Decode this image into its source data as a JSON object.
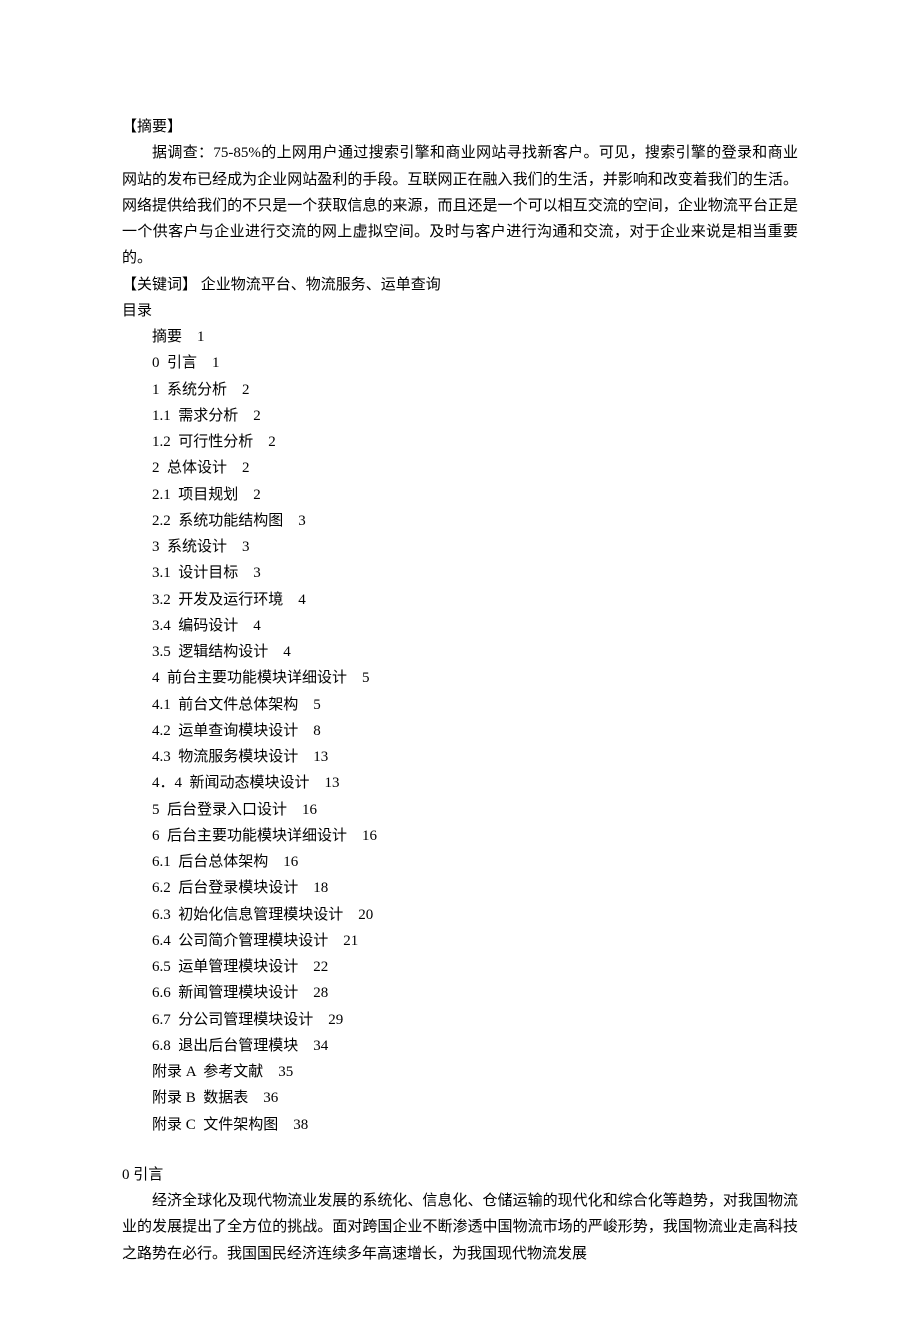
{
  "abstract": {
    "heading": "【摘要】",
    "body": "据调查：75-85%的上网用户通过搜索引擎和商业网站寻找新客户。可见，搜索引擎的登录和商业网站的发布已经成为企业网站盈利的手段。互联网正在融入我们的生活，并影响和改变着我们的生活。网络提供给我们的不只是一个获取信息的来源，而且还是一个可以相互交流的空间，企业物流平台正是一个供客户与企业进行交流的网上虚拟空间。及时与客户进行沟通和交流，对于企业来说是相当重要的。"
  },
  "keywords": {
    "heading": "【关键词】",
    "body": " 企业物流平台、物流服务、运单查询"
  },
  "toc": {
    "heading": "目录",
    "items": [
      {
        "label": "摘要",
        "page": "1"
      },
      {
        "label": "0  引言",
        "page": "1"
      },
      {
        "label": "1  系统分析",
        "page": "2"
      },
      {
        "label": "1.1  需求分析",
        "page": "2"
      },
      {
        "label": "1.2  可行性分析",
        "page": "2"
      },
      {
        "label": "2  总体设计",
        "page": "2"
      },
      {
        "label": "2.1  项目规划",
        "page": "2"
      },
      {
        "label": "2.2  系统功能结构图",
        "page": "3"
      },
      {
        "label": "3  系统设计",
        "page": "3"
      },
      {
        "label": "3.1  设计目标",
        "page": "3"
      },
      {
        "label": "3.2  开发及运行环境",
        "page": "4"
      },
      {
        "label": "3.4  编码设计",
        "page": "4"
      },
      {
        "label": "3.5  逻辑结构设计",
        "page": "4"
      },
      {
        "label": "4  前台主要功能模块详细设计",
        "page": "5"
      },
      {
        "label": "4.1  前台文件总体架构",
        "page": "5"
      },
      {
        "label": "4.2  运单查询模块设计",
        "page": "8"
      },
      {
        "label": "4.3  物流服务模块设计",
        "page": "13"
      },
      {
        "label": "4．4  新闻动态模块设计",
        "page": "13"
      },
      {
        "label": "5  后台登录入口设计",
        "page": "16"
      },
      {
        "label": "6  后台主要功能模块详细设计",
        "page": "16"
      },
      {
        "label": "6.1  后台总体架构",
        "page": "16"
      },
      {
        "label": "6.2  后台登录模块设计",
        "page": "18"
      },
      {
        "label": "6.3  初始化信息管理模块设计",
        "page": "20"
      },
      {
        "label": "6.4  公司简介管理模块设计",
        "page": "21"
      },
      {
        "label": "6.5  运单管理模块设计",
        "page": "22"
      },
      {
        "label": "6.6  新闻管理模块设计",
        "page": "28"
      },
      {
        "label": "6.7  分公司管理模块设计",
        "page": "29"
      },
      {
        "label": "6.8  退出后台管理模块",
        "page": "34"
      },
      {
        "label": "附录 A  参考文献",
        "page": "35"
      },
      {
        "label": "附录 B  数据表",
        "page": "36"
      },
      {
        "label": "附录 C  文件架构图",
        "page": "38"
      }
    ]
  },
  "intro": {
    "heading": "0  引言",
    "body": "经济全球化及现代物流业发展的系统化、信息化、仓储运输的现代化和综合化等趋势，对我国物流业的发展提出了全方位的挑战。面对跨国企业不断渗透中国物流市场的严峻形势，我国物流业走高科技之路势在必行。我国国民经济连续多年高速增长，为我国现代物流发展"
  }
}
